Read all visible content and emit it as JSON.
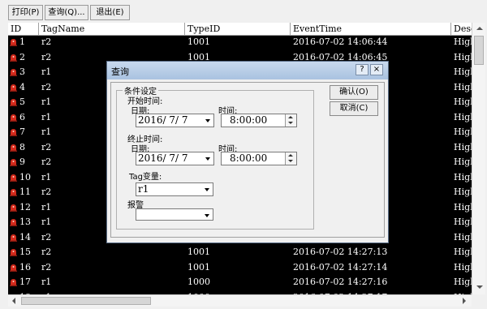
{
  "toolbar": {
    "print": "打印(P)",
    "query": "查询(Q)...",
    "exit": "退出(E)"
  },
  "grid": {
    "columns": [
      "ID",
      "TagName",
      "TypeID",
      "EventTime",
      "Desc"
    ],
    "rows": [
      {
        "id": "1",
        "tag": "r2",
        "type": "1001",
        "time": "2016-07-02 14:06:44",
        "desc": "High"
      },
      {
        "id": "2",
        "tag": "r2",
        "type": "1001",
        "time": "2016-07-02 14:06:45",
        "desc": "High"
      },
      {
        "id": "3",
        "tag": "r1",
        "type": "",
        "time": "",
        "desc": "High"
      },
      {
        "id": "4",
        "tag": "r2",
        "type": "",
        "time": "",
        "desc": "High"
      },
      {
        "id": "5",
        "tag": "r1",
        "type": "",
        "time": "",
        "desc": "High"
      },
      {
        "id": "6",
        "tag": "r1",
        "type": "",
        "time": "",
        "desc": "High"
      },
      {
        "id": "7",
        "tag": "r1",
        "type": "",
        "time": "",
        "desc": "High"
      },
      {
        "id": "8",
        "tag": "r2",
        "type": "",
        "time": "",
        "desc": "High"
      },
      {
        "id": "9",
        "tag": "r2",
        "type": "",
        "time": "",
        "desc": "High"
      },
      {
        "id": "10",
        "tag": "r1",
        "type": "",
        "time": "",
        "desc": "High"
      },
      {
        "id": "11",
        "tag": "r2",
        "type": "",
        "time": "",
        "desc": "High"
      },
      {
        "id": "12",
        "tag": "r1",
        "type": "",
        "time": "",
        "desc": "High"
      },
      {
        "id": "13",
        "tag": "r1",
        "type": "",
        "time": "",
        "desc": "High"
      },
      {
        "id": "14",
        "tag": "r2",
        "type": "",
        "time": "",
        "desc": "High"
      },
      {
        "id": "15",
        "tag": "r2",
        "type": "1001",
        "time": "2016-07-02 14:27:13",
        "desc": "High"
      },
      {
        "id": "16",
        "tag": "r2",
        "type": "1001",
        "time": "2016-07-02 14:27:14",
        "desc": "High"
      },
      {
        "id": "17",
        "tag": "r1",
        "type": "1000",
        "time": "2016-07-02 14:27:16",
        "desc": "High"
      },
      {
        "id": "18",
        "tag": "r1",
        "type": "1000",
        "time": "2016-07-02 14:27:17",
        "desc": "High"
      }
    ]
  },
  "dialog": {
    "title": "查询",
    "help": "?",
    "close": "×",
    "group": "条件设定",
    "start_label": "开始时间:",
    "end_label": "终止时间:",
    "date_label": "日期:",
    "time_label": "时间:",
    "start_date": "2016/ 7/ 7",
    "start_time": "8:00:00",
    "end_date": "2016/ 7/ 7",
    "end_time": "8:00:00",
    "tag_label": "Tag变量:",
    "tag_value": "r1",
    "alarm_label": "报警",
    "alarm_value": "",
    "ok": "确认(O)",
    "cancel": "取消(C)"
  },
  "colors": {
    "grid_bg": "#000000",
    "grid_text": "#ffffff",
    "alarm_icon": "#d42a1c",
    "title_bar": "#b8cde8"
  }
}
